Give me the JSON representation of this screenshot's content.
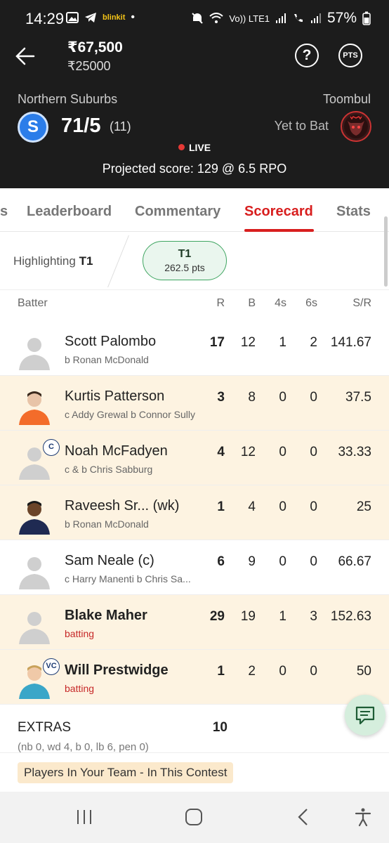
{
  "status_bar": {
    "time": "14:29",
    "carrier_tag": "blinkit",
    "signal_text_1": "Vo)) LTE1",
    "battery": "57%"
  },
  "header": {
    "prize": "₹67,500",
    "entry": "₹25000",
    "pts_label": "PTS",
    "help_label": "?"
  },
  "match": {
    "team1_name": "Northern Suburbs",
    "team1_logo_text": "S",
    "team1_score": "71/5",
    "team1_overs": "(11)",
    "team2_name": "Toombul",
    "team2_status": "Yet to Bat",
    "live_label": "LIVE",
    "projected": "Projected score: 129 @ 6.5 RPO"
  },
  "tabs": [
    {
      "label": "s"
    },
    {
      "label": "Leaderboard"
    },
    {
      "label": "Commentary"
    },
    {
      "label": "Scorecard"
    },
    {
      "label": "Stats"
    }
  ],
  "highlight": {
    "prefix": "Highlighting",
    "team": "T1",
    "chip_name": "T1",
    "chip_points": "262.5 pts"
  },
  "table": {
    "headers": {
      "batter": "Batter",
      "r": "R",
      "b": "B",
      "fours": "4s",
      "sixes": "6s",
      "sr": "S/R"
    },
    "rows": [
      {
        "name": "Scott Palombo",
        "dismissal": "b Ronan McDonald",
        "r": "17",
        "b": "12",
        "fours": "1",
        "sixes": "2",
        "sr": "141.67",
        "badge": ""
      },
      {
        "name": "Kurtis Patterson",
        "dismissal": "c Addy Grewal b Connor Sully",
        "r": "3",
        "b": "8",
        "fours": "0",
        "sixes": "0",
        "sr": "37.5",
        "badge": ""
      },
      {
        "name": "Noah McFadyen",
        "dismissal": "c & b Chris Sabburg",
        "r": "4",
        "b": "12",
        "fours": "0",
        "sixes": "0",
        "sr": "33.33",
        "badge": "C"
      },
      {
        "name": "Raveesh Sr... (wk)",
        "dismissal": "b Ronan McDonald",
        "r": "1",
        "b": "4",
        "fours": "0",
        "sixes": "0",
        "sr": "25",
        "badge": ""
      },
      {
        "name": "Sam Neale (c)",
        "dismissal": "c Harry Manenti b Chris Sa...",
        "r": "6",
        "b": "9",
        "fours": "0",
        "sixes": "0",
        "sr": "66.67",
        "badge": ""
      },
      {
        "name": "Blake Maher",
        "dismissal": "batting",
        "r": "29",
        "b": "19",
        "fours": "1",
        "sixes": "3",
        "sr": "152.63",
        "badge": ""
      },
      {
        "name": "Will Prestwidge",
        "dismissal": "batting",
        "r": "1",
        "b": "2",
        "fours": "0",
        "sixes": "0",
        "sr": "50",
        "badge": "VC"
      }
    ]
  },
  "extras": {
    "label": "EXTRAS",
    "value": "10",
    "detail": "(nb 0, wd 4, b 0, lb 6, pen 0)"
  },
  "players_banner": "Players In Your Team - In This Contest",
  "colors": {
    "accent": "#d81e1e",
    "header_bg": "#1c1c1c",
    "highlight_row": "#fdf3e1",
    "chip_green": "#3fa561"
  }
}
